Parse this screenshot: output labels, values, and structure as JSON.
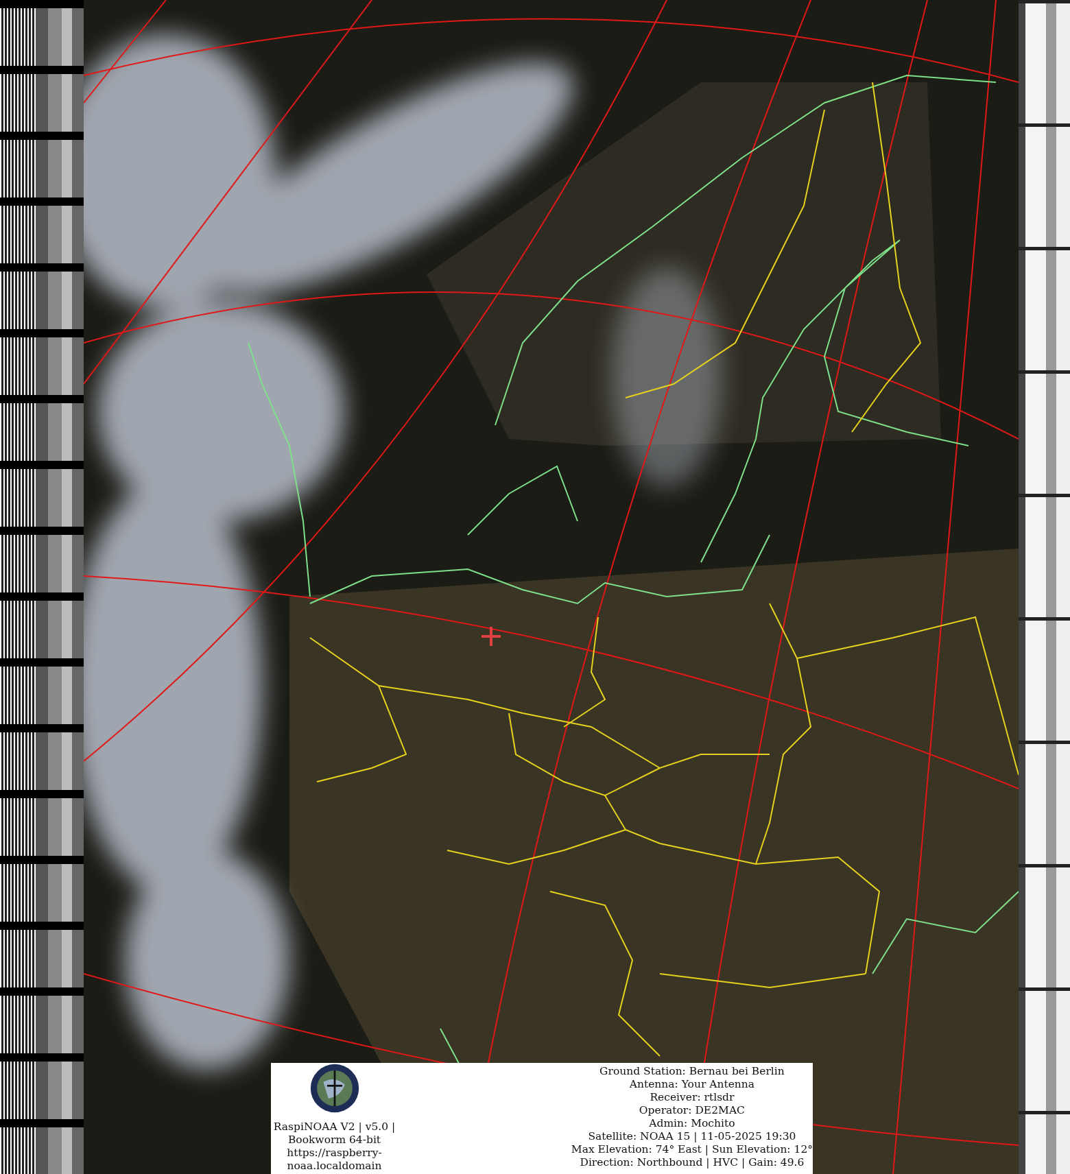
{
  "info_panel": {
    "software_lines": [
      "RaspiNOAA V2 | v5.0 |",
      "Bookworm 64-bit",
      "https://raspberry-",
      "noaa.localdomain"
    ],
    "station_lines": [
      "Ground Station: Bernau bei Berlin",
      "Antenna: Your Antenna",
      "Receiver: rtlsdr",
      "Operator: DE2MAC",
      "Admin: Mochito",
      "Satellite: NOAA 15 | 11-05-2025 19:30",
      "Max Elevation: 74° East | Sun Elevation: 12°",
      "Direction: Northbound | HVC | Gain: 49.6"
    ]
  }
}
